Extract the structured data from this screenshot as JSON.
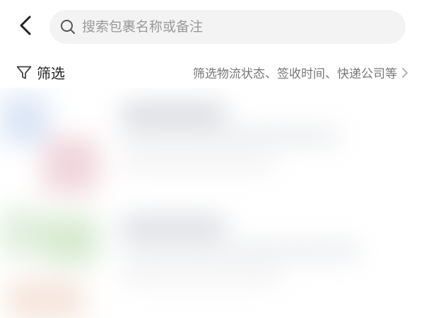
{
  "header": {
    "search_placeholder": "搜索包裹名称或备注"
  },
  "filter": {
    "label": "筛选",
    "hint": "筛选物流状态、签收时间、快递公司等"
  },
  "icons": {
    "back": "chevron-left-icon",
    "search": "search-icon",
    "filter": "funnel-icon",
    "hint_arrow": "chevron-right-icon"
  }
}
